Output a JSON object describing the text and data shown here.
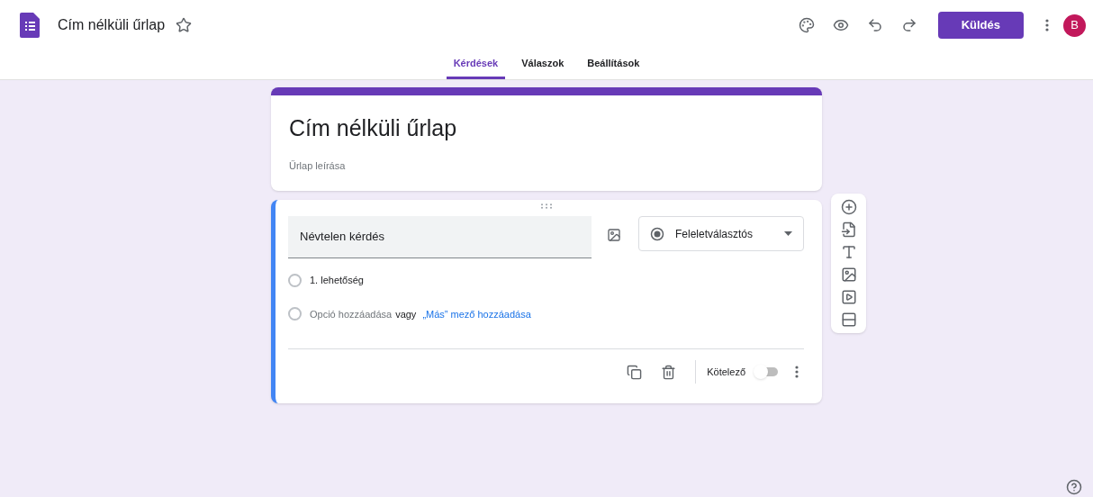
{
  "header": {
    "title": "Cím nélküli űrlap",
    "send_button": "Küldés",
    "avatar": "B"
  },
  "tabs": [
    {
      "label": "Kérdések",
      "selected": true
    },
    {
      "label": "Válaszok",
      "selected": false
    },
    {
      "label": "Beállítások",
      "selected": false
    }
  ],
  "form": {
    "title": "Cím nélküli űrlap",
    "description_placeholder": "Űrlap leírása"
  },
  "question": {
    "title": "Névtelen kérdés",
    "type": "Feleletválasztós",
    "options": [
      {
        "label": "1. lehetőség",
        "checked": false
      }
    ],
    "add_option": "Opció hozzáadása",
    "add_option_checked": false,
    "or": "vagy",
    "add_other": "„Más” mező hozzáadása",
    "required_label": "Kötelező",
    "required": false
  }
}
